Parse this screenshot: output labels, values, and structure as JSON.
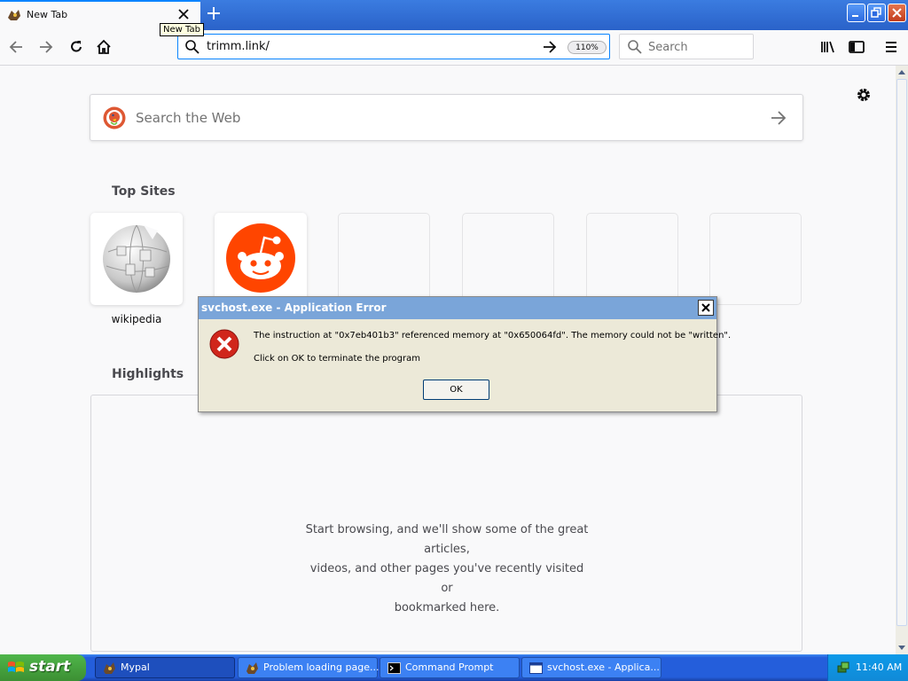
{
  "browser": {
    "tab": {
      "title": "New Tab",
      "tooltip": "New Tab"
    },
    "url": "trimm.link/",
    "zoom": "110%",
    "search_placeholder": "Search"
  },
  "newtab": {
    "web_search_placeholder": "Search the Web",
    "top_sites_heading": "Top Sites",
    "top_sites": [
      {
        "label": "wikipedia"
      },
      {
        "label": ""
      }
    ],
    "highlights_heading": "Highlights",
    "highlights_message_lines": [
      "Start browsing, and we'll show some of the great articles,",
      "videos, and other pages you've recently visited or",
      "bookmarked here."
    ]
  },
  "dialog": {
    "title": "svchost.exe - Application Error",
    "message": "The instruction at \"0x7eb401b3\" referenced memory at \"0x650064fd\". The memory could not be \"written\".",
    "message2": "Click on OK to terminate the program",
    "ok_label": "OK"
  },
  "taskbar": {
    "start_label": "start",
    "tasks": [
      {
        "label": "Mypal",
        "icon": "mypal-icon"
      },
      {
        "label": "Problem loading page...",
        "icon": "mypal-icon"
      },
      {
        "label": "Command Prompt",
        "icon": "cmd-icon"
      },
      {
        "label": "svchost.exe - Applica...",
        "icon": "window-icon"
      }
    ],
    "clock": "11:40 AM"
  },
  "colors": {
    "accent": "#0a84ff",
    "xp_blue": "#245edb",
    "xp_start_green": "#3c8f33",
    "reddit_orange": "#ff4500",
    "error_red": "#d0261b"
  }
}
